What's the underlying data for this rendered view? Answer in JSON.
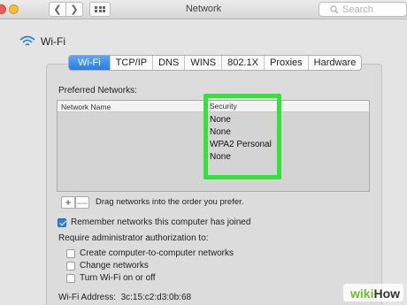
{
  "window": {
    "title": "Network"
  },
  "toolbar": {
    "search_placeholder": "Search"
  },
  "header": {
    "label": "Wi-Fi"
  },
  "tabs": [
    "Wi-Fi",
    "TCP/IP",
    "DNS",
    "WINS",
    "802.1X",
    "Proxies",
    "Hardware"
  ],
  "preferred": {
    "label": "Preferred Networks:",
    "columns": {
      "name": "Network Name",
      "security": "Security"
    },
    "rows": [
      {
        "security": "None"
      },
      {
        "security": "None"
      },
      {
        "security": "WPA2 Personal"
      },
      {
        "security": "None"
      }
    ],
    "add_label": "+",
    "remove_label": "—",
    "drag_hint": "Drag networks into the order you prefer."
  },
  "options": {
    "remember": {
      "label": "Remember networks this computer has joined",
      "checked": true
    },
    "require_label": "Require administrator authorization to:",
    "admin": [
      {
        "label": "Create computer-to-computer networks",
        "checked": false
      },
      {
        "label": "Change networks",
        "checked": false
      },
      {
        "label": "Turn Wi-Fi on or off",
        "checked": false
      }
    ],
    "wifi_address": "Wi-Fi Address:  3c:15:c2:d3:0b:68"
  },
  "highlight_color": "#36e23a",
  "accent_color": "#2a7ee3",
  "watermark": {
    "wiki": "wiki",
    "how": "How"
  }
}
